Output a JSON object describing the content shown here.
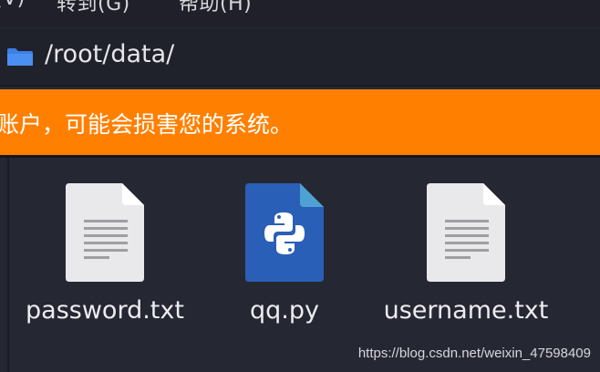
{
  "menubar": {
    "items": [
      {
        "label": "(V)"
      },
      {
        "label": "转到(G)"
      },
      {
        "label": "帮助(H)"
      }
    ]
  },
  "location": {
    "icon": "folder-icon",
    "path": "/root/data/"
  },
  "warning": {
    "text": "账户，可能会损害您的系统。",
    "color": "#ff8000"
  },
  "files": [
    {
      "name": "password.txt",
      "icon": "text-file-icon"
    },
    {
      "name": "qq.py",
      "icon": "python-file-icon"
    },
    {
      "name": "username.txt",
      "icon": "text-file-icon"
    }
  ],
  "watermark": "https://blog.csdn.net/weixin_47598409"
}
